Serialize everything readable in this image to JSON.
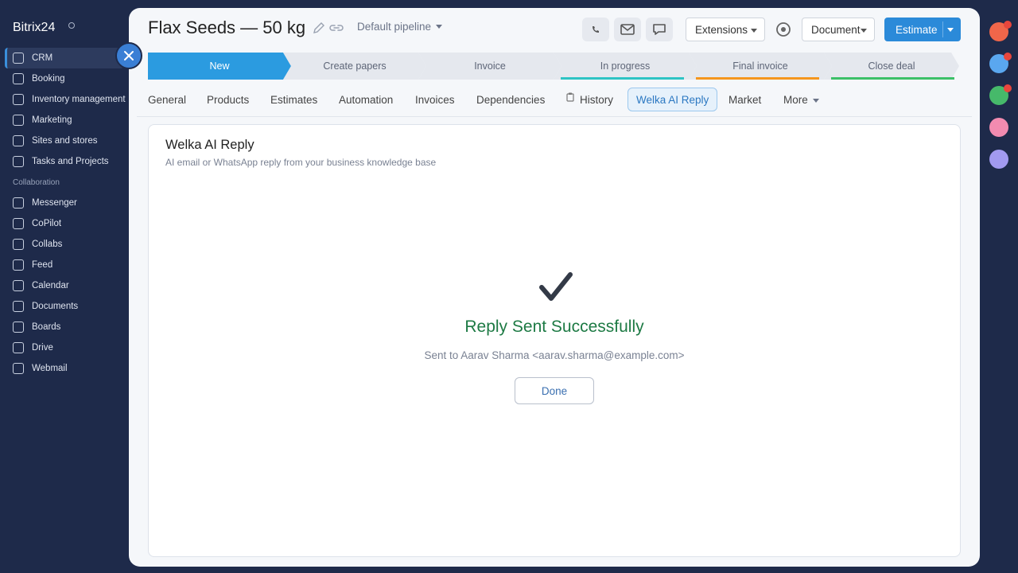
{
  "app": {
    "brand": "Bitrix24"
  },
  "sidebar": {
    "items": [
      {
        "label": "CRM",
        "active": true
      },
      {
        "label": "Booking"
      },
      {
        "label": "Inventory management"
      },
      {
        "label": "Marketing"
      },
      {
        "label": "Sites and stores"
      },
      {
        "label": "Tasks and Projects"
      }
    ],
    "section": "Collaboration",
    "collab_items": [
      {
        "label": "Messenger"
      },
      {
        "label": "CoPilot"
      },
      {
        "label": "Collabs"
      },
      {
        "label": "Feed"
      },
      {
        "label": "Calendar"
      },
      {
        "label": "Documents"
      },
      {
        "label": "Boards"
      },
      {
        "label": "Drive"
      },
      {
        "label": "Webmail"
      }
    ]
  },
  "header": {
    "title": "Flax Seeds — 50 kg",
    "pipeline": "Default pipeline",
    "extensions_label": "Extensions",
    "document_label": "Document",
    "estimate_label": "Estimate"
  },
  "stages": [
    {
      "label": "New",
      "color": "#2b9be0",
      "active": true
    },
    {
      "label": "Create papers",
      "color": ""
    },
    {
      "label": "Invoice",
      "color": ""
    },
    {
      "label": "In progress",
      "color": "#2ec4c4"
    },
    {
      "label": "Final invoice",
      "color": "#f5961e"
    },
    {
      "label": "Close deal",
      "color": "#3cc068"
    }
  ],
  "tabs": [
    {
      "label": "General"
    },
    {
      "label": "Products"
    },
    {
      "label": "Estimates"
    },
    {
      "label": "Automation"
    },
    {
      "label": "Invoices"
    },
    {
      "label": "Dependencies"
    },
    {
      "label": "History"
    },
    {
      "label": "Welka AI Reply",
      "active": true
    },
    {
      "label": "Market"
    },
    {
      "label": "More"
    }
  ],
  "panel": {
    "title": "Welka AI Reply",
    "subtitle": "AI email or WhatsApp reply from your business knowledge base",
    "success_message": "Reply Sent Successfully",
    "sent_to": "Sent to Aarav Sharma <aarav.sharma@example.com>",
    "done_label": "Done"
  },
  "colors": {
    "sidebar_bg": "#1e2a4a",
    "accent": "#2b8ad9",
    "success": "#1d7a44",
    "rail": [
      "#f0664a",
      "#5aa7ef",
      "#46b96a",
      "#f28bb0",
      "#a29af0"
    ]
  }
}
